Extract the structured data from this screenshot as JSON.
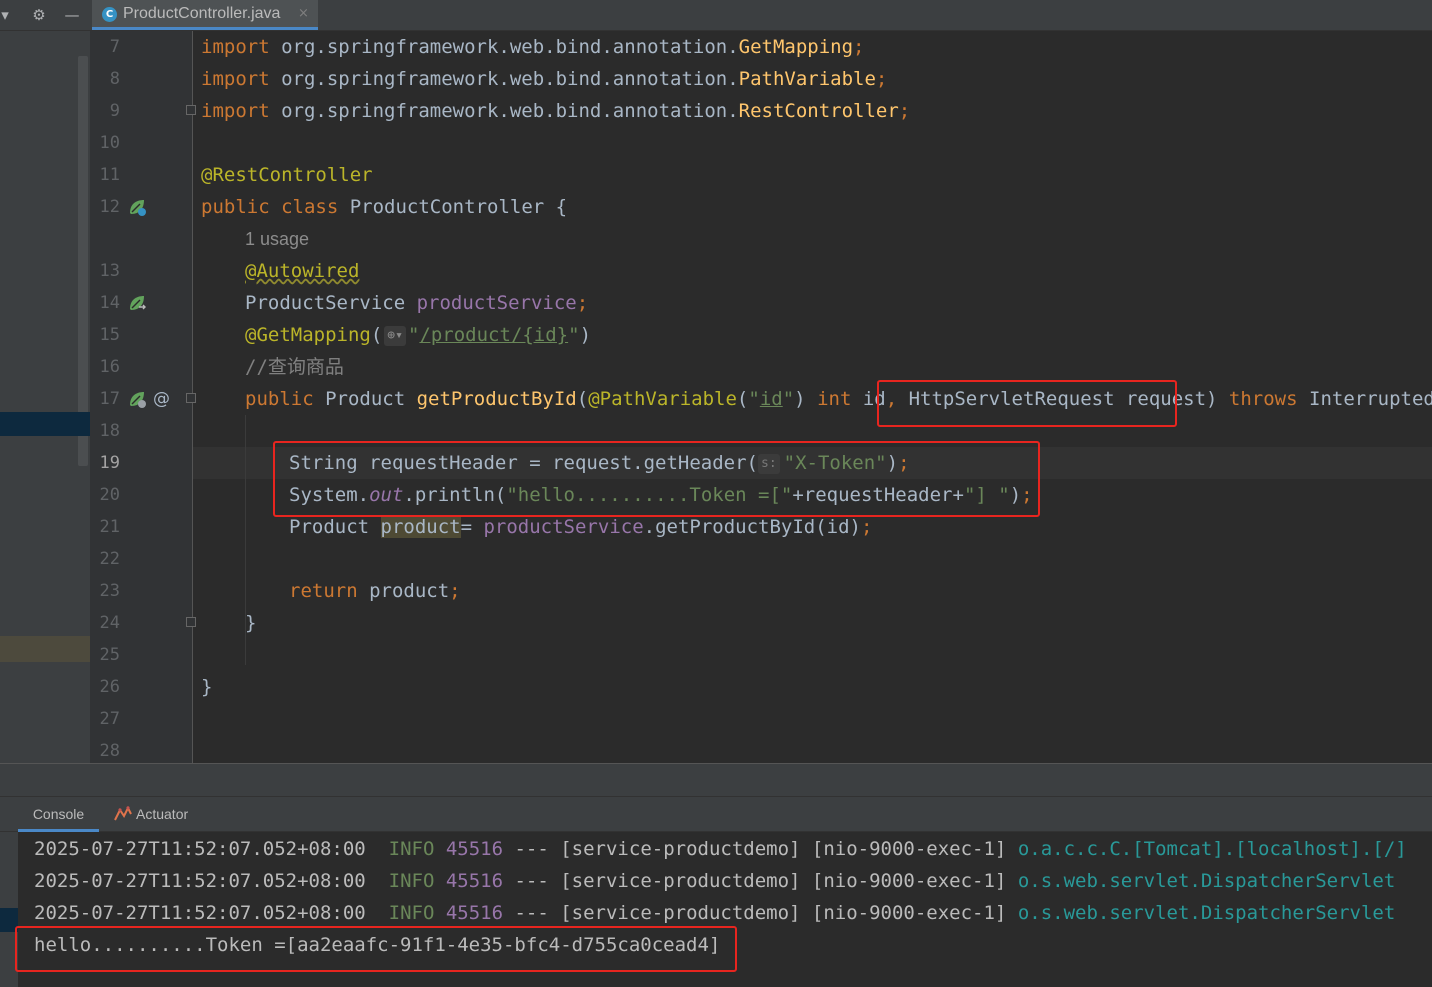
{
  "tab": {
    "label": "ProductController.java",
    "file_icon": "C",
    "close": "×"
  },
  "toolbar": {
    "settings_icon": "⚙",
    "minimize_icon": "—"
  },
  "gutter": {
    "line_numbers": [
      "7",
      "8",
      "9",
      "10",
      "11",
      "12",
      "13",
      "14",
      "15",
      "16",
      "17",
      "18",
      "19",
      "20",
      "21",
      "22",
      "23",
      "24",
      "25",
      "26",
      "27",
      "28"
    ],
    "at_marker": "@"
  },
  "code": {
    "l7": {
      "kw": "import",
      "pkg": " org.springframework.web.bind.annotation.",
      "cls": "GetMapping",
      "semi": ";"
    },
    "l8": {
      "kw": "import",
      "pkg": " org.springframework.web.bind.annotation.",
      "cls": "PathVariable",
      "semi": ";"
    },
    "l9": {
      "kw": "import",
      "pkg": " org.springframework.web.bind.annotation.",
      "cls": "RestController",
      "semi": ";"
    },
    "l11": {
      "ann": "@RestController"
    },
    "l12": {
      "kw1": "public",
      "kw2": "class",
      "rest": " ProductController {"
    },
    "usage": "1 usage",
    "l13": {
      "ann": "@Autowired"
    },
    "l14": {
      "type": "ProductService ",
      "field": "productService",
      "semi": ";"
    },
    "l15": {
      "ann": "@GetMapping",
      "p1": "(",
      "q1": "\"",
      "path": "/product/{id}",
      "q2": "\"",
      "p2": ")"
    },
    "l16": {
      "comment": "//查询商品"
    },
    "l17": {
      "kw": "public",
      "t1": " Product ",
      "mth": "getProductById",
      "p1": "(",
      "ann": "@PathVariable",
      "p2": "(",
      "q1": "\"",
      "id": "id",
      "q2": "\"",
      "p3": ") ",
      "kw2": "int",
      "t2": " id",
      "comma": ", ",
      "param": "HttpServletRequest request",
      "p4": ")",
      "kw3": " throws",
      "t3": " InterruptedExce"
    },
    "l19": {
      "t1": "String requestHeader = request.getHeader(",
      "hint": "s:",
      "str": "\"X-Token\"",
      "t2": ")",
      "semi": ";"
    },
    "l20": {
      "t1": "System.",
      "out": "out",
      "t2": ".println(",
      "s1": "\"hello..........Token =[\"",
      "t3": "+requestHeader+",
      "s2": "\"] \"",
      "t4": ")",
      "semi": ";"
    },
    "l21": {
      "t1": "Product ",
      "var": "product",
      "t2": "= ",
      "field": "productService",
      "t3": ".getProductById(id)",
      "semi": ";"
    },
    "l23": {
      "kw": "return",
      "t1": " product",
      "semi": ";"
    },
    "l24": {
      "t1": "}"
    },
    "l26": {
      "t1": "}"
    }
  },
  "console": {
    "tabs": {
      "console": "Console",
      "actuator": "Actuator"
    },
    "lines": [
      {
        "ts": "2025-07-27T11:52:07.052+08:00",
        "level": "INFO",
        "pid": "45516",
        "rest": " --- [service-productdemo] [nio-9000-exec-1] ",
        "logger": "o.a.c.c.C.[Tomcat].[localhost].[/]"
      },
      {
        "ts": "2025-07-27T11:52:07.052+08:00",
        "level": "INFO",
        "pid": "45516",
        "rest": " --- [service-productdemo] [nio-9000-exec-1] ",
        "logger": "o.s.web.servlet.DispatcherServlet"
      },
      {
        "ts": "2025-07-27T11:52:07.052+08:00",
        "level": "INFO",
        "pid": "45516",
        "rest": " --- [service-productdemo] [nio-9000-exec-1] ",
        "logger": "o.s.web.servlet.DispatcherServlet"
      }
    ],
    "output": "hello..........Token =[aa2eaafc-91f1-4e35-bfc4-d755ca0cead4]"
  },
  "colors": {
    "highlight_box": "#e8251f",
    "keyword": "#cc7832",
    "annotation": "#bbb529",
    "string": "#6a8759",
    "field": "#9876aa",
    "method": "#ffc66d"
  }
}
